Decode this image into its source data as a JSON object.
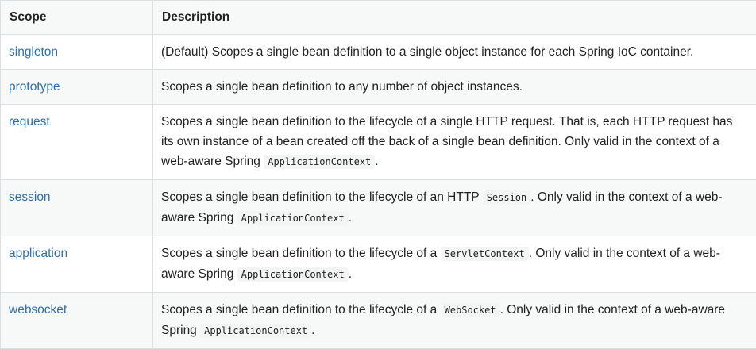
{
  "headers": {
    "scope": "Scope",
    "description": "Description"
  },
  "rows": [
    {
      "scope": "singleton",
      "parts": [
        {
          "t": "text",
          "v": "(Default) Scopes a single bean definition to a single object instance for each Spring IoC container."
        }
      ]
    },
    {
      "scope": "prototype",
      "parts": [
        {
          "t": "text",
          "v": "Scopes a single bean definition to any number of object instances."
        }
      ]
    },
    {
      "scope": "request",
      "parts": [
        {
          "t": "text",
          "v": "Scopes a single bean definition to the lifecycle of a single HTTP request. That is, each HTTP request has its own instance of a bean created off the back of a single bean definition. Only valid in the context of a web-aware Spring "
        },
        {
          "t": "code",
          "v": "ApplicationContext"
        },
        {
          "t": "text",
          "v": "."
        }
      ]
    },
    {
      "scope": "session",
      "parts": [
        {
          "t": "text",
          "v": "Scopes a single bean definition to the lifecycle of an HTTP "
        },
        {
          "t": "code",
          "v": "Session"
        },
        {
          "t": "text",
          "v": ". Only valid in the context of a web-aware Spring "
        },
        {
          "t": "code",
          "v": "ApplicationContext"
        },
        {
          "t": "text",
          "v": "."
        }
      ]
    },
    {
      "scope": "application",
      "parts": [
        {
          "t": "text",
          "v": "Scopes a single bean definition to the lifecycle of a "
        },
        {
          "t": "code",
          "v": "ServletContext"
        },
        {
          "t": "text",
          "v": ". Only valid in the context of a web-aware Spring "
        },
        {
          "t": "code",
          "v": "ApplicationContext"
        },
        {
          "t": "text",
          "v": "."
        }
      ]
    },
    {
      "scope": "websocket",
      "parts": [
        {
          "t": "text",
          "v": "Scopes a single bean definition to the lifecycle of a "
        },
        {
          "t": "code",
          "v": "WebSocket"
        },
        {
          "t": "text",
          "v": ". Only valid in the context of a web-aware Spring "
        },
        {
          "t": "code",
          "v": "ApplicationContext"
        },
        {
          "t": "text",
          "v": "."
        }
      ]
    }
  ]
}
